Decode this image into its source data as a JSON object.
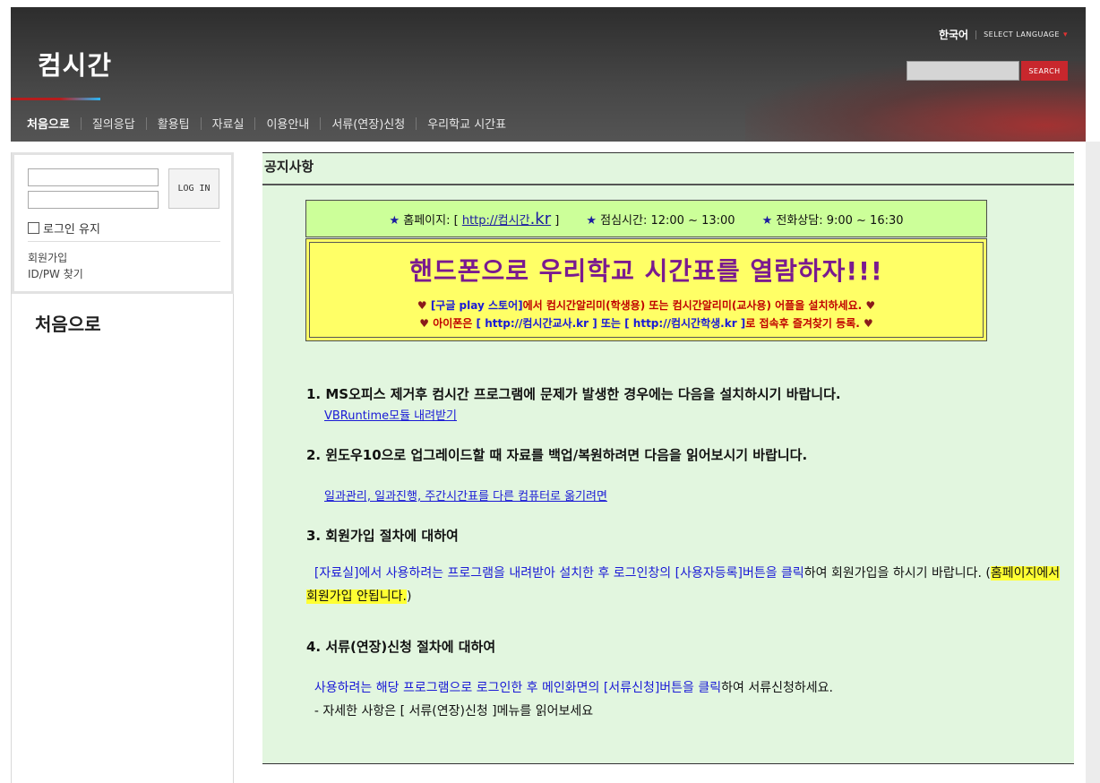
{
  "header": {
    "site_title": "컴시간",
    "language": {
      "current": "한국어",
      "select_label": "SELECT LANGUAGE"
    },
    "search": {
      "placeholder": "",
      "button_label": "SEARCH"
    },
    "nav": [
      {
        "label": "처음으로",
        "active": true
      },
      {
        "label": "질의응답"
      },
      {
        "label": "활용팁"
      },
      {
        "label": "자료실"
      },
      {
        "label": "이용안내"
      },
      {
        "label": "서류(연장)신청"
      },
      {
        "label": "우리학교 시간표"
      }
    ]
  },
  "sidebar": {
    "login": {
      "id_value": "",
      "pw_value": "",
      "button_label": "LOG IN",
      "keep_label": "로그인 유지",
      "keep_checked": false,
      "signup_label": "회원가입",
      "find_label": "ID/PW 찾기"
    },
    "section_title": "처음으로"
  },
  "content": {
    "heading": "공지사항",
    "info_bar": {
      "homepage_prefix": "홈페이지: [",
      "homepage_link_a": "http://컴시간",
      "homepage_link_b": ".kr",
      "homepage_suffix": "]",
      "lunch": "점심시간: 12:00 ~ 13:00",
      "phone": "전화상담: 9:00 ~ 16:30"
    },
    "promo": {
      "title": "핸드폰으로 우리학교 시간표를 열람하자!!!",
      "line1_a": "[구글 play 스토어]",
      "line1_b": "에서 컴시간알리미(학생용) 또는 컴시간알리미(교사용) 어플을 설치하세요.",
      "line2_a": "아이폰은",
      "line2_b": "[ http://컴시간교사.kr ] 또는 [ http://컴시간학생.kr ]",
      "line2_c": "로 접속후 즐겨찾기 등록."
    },
    "sections": [
      {
        "title": "1. MS오피스 제거후 컴시간 프로그램에 문제가 발생한 경우에는 다음을 설치하시기 바랍니다.",
        "link": "VBRuntime모듈 내려받기"
      },
      {
        "title": "2. 윈도우10으로 업그레이드할 때 자료를 백업/복원하려면 다음을 읽어보시기 바랍니다.",
        "link": "일과관리, 일과진행, 주간시간표를 다른 컴퓨터로 옮기려면"
      },
      {
        "title": "3. 회원가입 절차에 대하여",
        "para_blue": "[자료실]에서 사용하려는 프로그램을 내려받아 설치한 후 로그인창의 [사용자등록]버튼을 클릭",
        "para_rest": "하여 회원가입을 하시기 바랍니다. (",
        "para_highlight": "홈페이지에서 회원가입 안됩니다.",
        "para_end": ")"
      },
      {
        "title": "4. 서류(연장)신청 절차에 대하여",
        "para_blue": "사용하려는 해당 프로그램으로 로그인한 후 메인화면의 [서류신청]버튼을 클릭",
        "para_rest": "하여 서류신청하세요.",
        "para_line2": "- 자세한 사항은 [ 서류(연장)신청 ]메뉴를 읽어보세요"
      }
    ]
  },
  "colors": {
    "header_bg": "#3a3a3a",
    "search_button": "#c8272d",
    "content_bg": "#e2f6df",
    "info_bar_bg": "#ccff99",
    "promo_bg": "#ffff66",
    "promo_title": "#7a1a8f",
    "link_blue": "#1a1ad6",
    "highlight": "#ffff33"
  },
  "icons": {
    "star": "★",
    "heart": "♥",
    "dropdown": "▾"
  }
}
